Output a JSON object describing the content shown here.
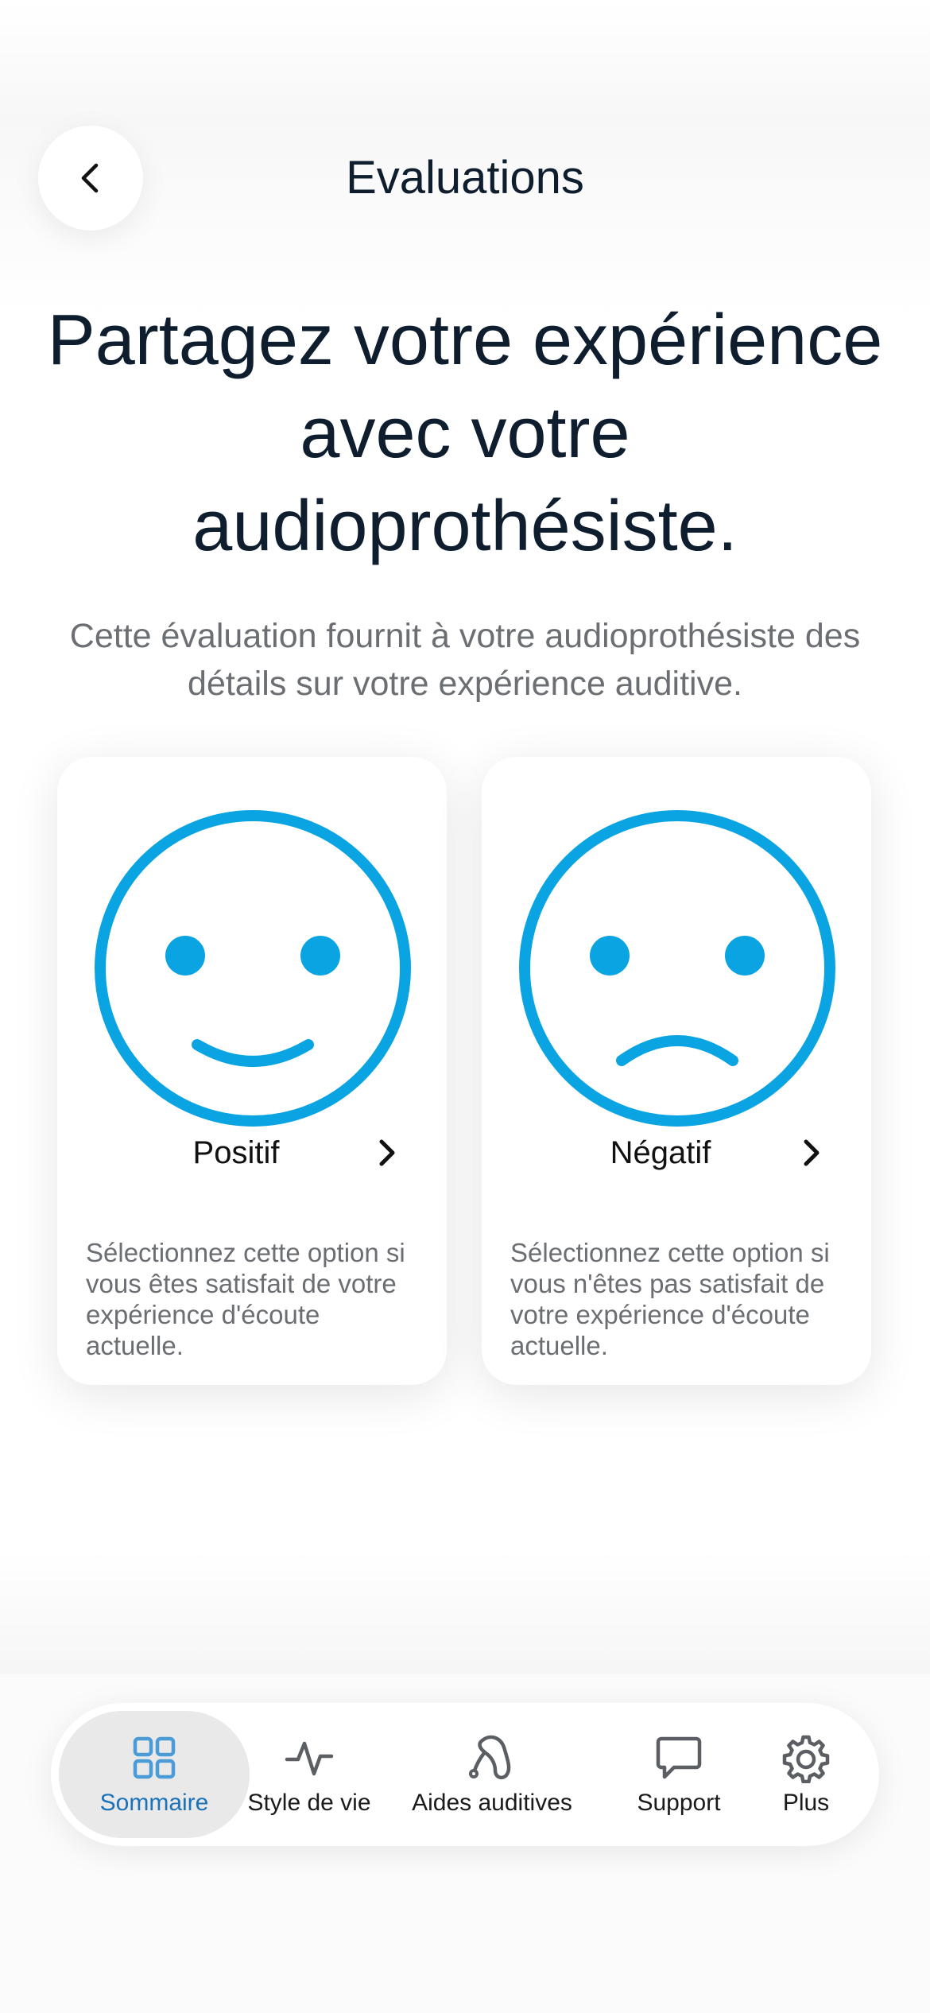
{
  "header": {
    "title": "Evaluations",
    "back_icon": "chevron-left-icon"
  },
  "main": {
    "headline": "Partagez votre expérience avec votre audioprothésiste.",
    "subtext": "Cette évaluation fournit à votre audioprothésiste des détails sur votre expérience auditive.",
    "options": [
      {
        "label": "Positif",
        "icon": "smiley-happy-icon",
        "description": "Sélectionnez cette option si vous êtes satisfait de votre expérience d'écoute actuelle."
      },
      {
        "label": "Négatif",
        "icon": "smiley-sad-icon",
        "description": "Sélectionnez cette option si vous n'êtes pas satisfait de votre expérience d'écoute actuelle."
      }
    ]
  },
  "tabbar": {
    "active_index": 0,
    "items": [
      {
        "label": "Sommaire",
        "icon": "grid-icon"
      },
      {
        "label": "Style de vie",
        "icon": "activity-icon"
      },
      {
        "label": "Aides auditives",
        "icon": "hearing-aid-icon"
      },
      {
        "label": "Support",
        "icon": "chat-bubble-icon"
      },
      {
        "label": "Plus",
        "icon": "gear-icon"
      }
    ]
  },
  "colors": {
    "accent_blue": "#0aa4e3",
    "active_tab_blue": "#1c72b8",
    "text_dark": "#0e1e2e",
    "text_muted": "#6b6e72"
  }
}
